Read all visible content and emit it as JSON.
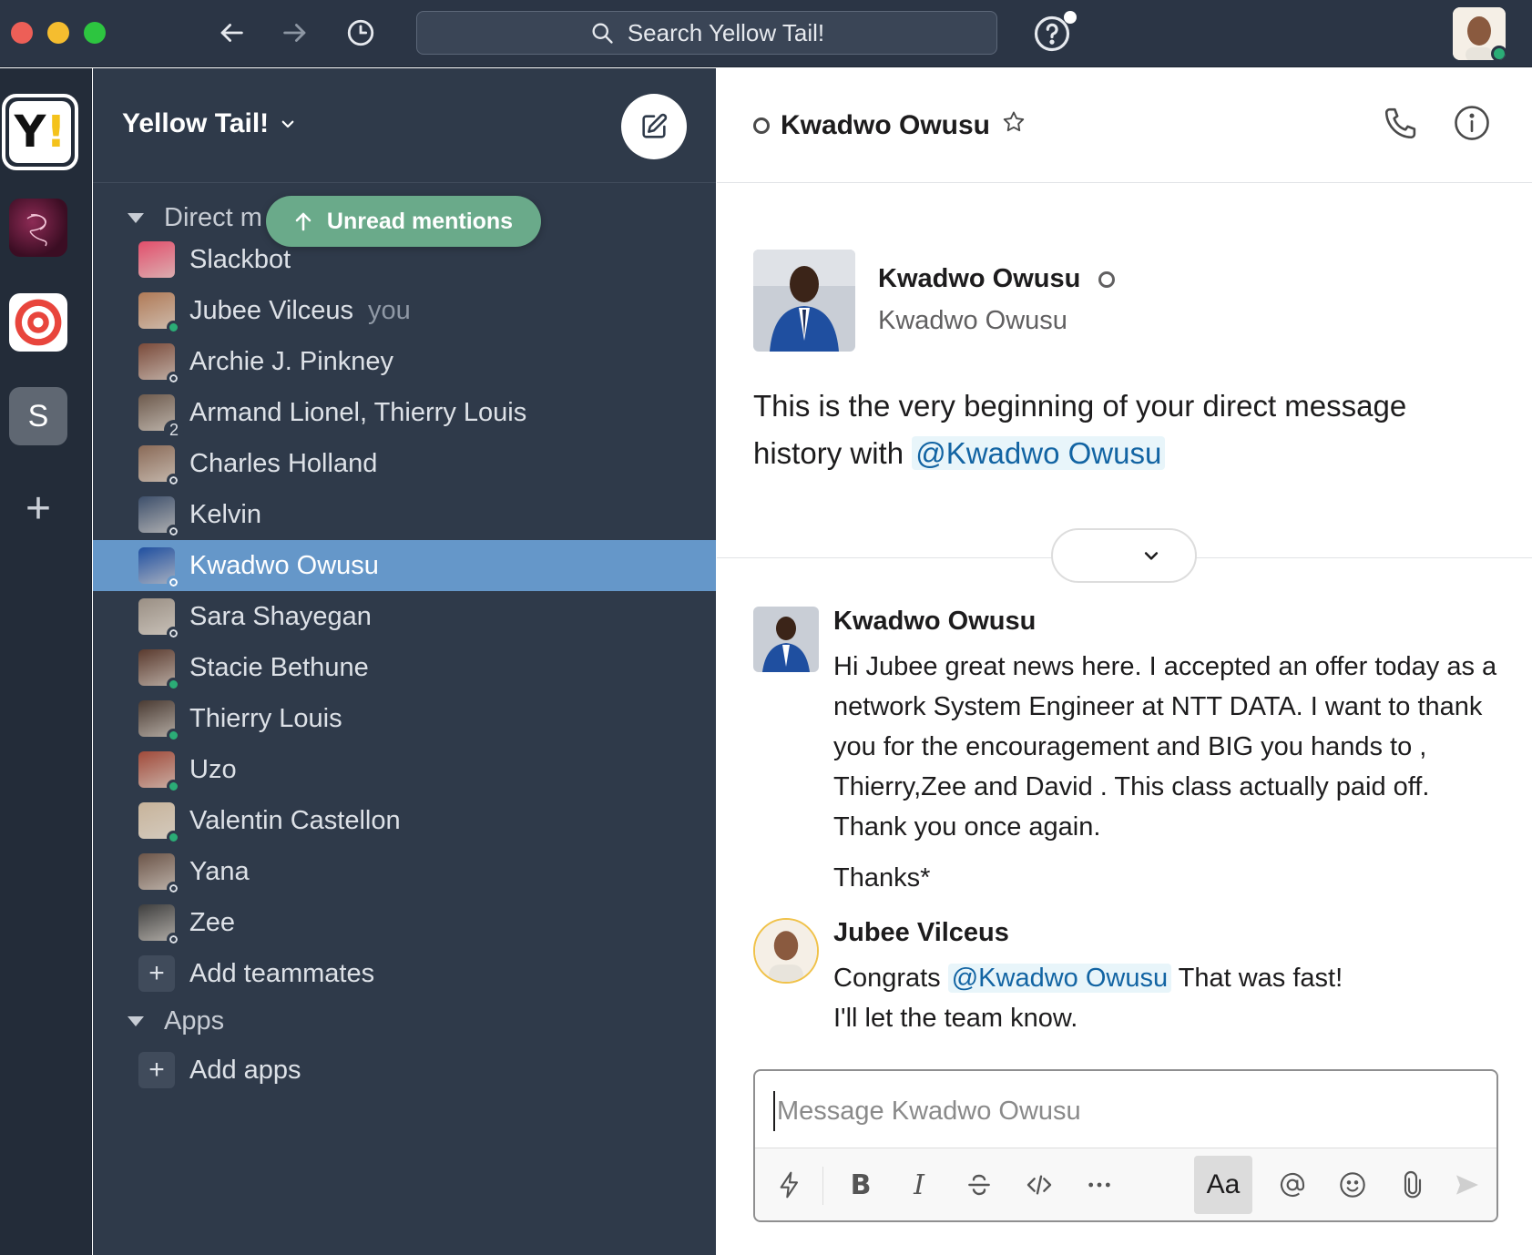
{
  "titlebar": {
    "search_label": "Search Yellow Tail!"
  },
  "workspaces": {
    "active_letter": "Y",
    "active_accent": "!",
    "fourth_letter": "S"
  },
  "sidebar": {
    "workspace_name": "Yellow Tail!",
    "section_dm": "Direct m",
    "unread_pill": "Unread mentions",
    "you_tag": "you",
    "dms": [
      {
        "name": "Slackbot",
        "status": "none",
        "color": "#e24e6b"
      },
      {
        "name": "Jubee Vilceus",
        "status": "online",
        "color": "#b07a57"
      },
      {
        "name": "Archie J. Pinkney",
        "status": "away",
        "color": "#7a4a3a"
      },
      {
        "name": "Armand Lionel, Thierry Louis",
        "status": "count",
        "count": "2",
        "color": "#6d5a4d"
      },
      {
        "name": "Charles Holland",
        "status": "away",
        "color": "#8a6a57"
      },
      {
        "name": "Kelvin",
        "status": "away",
        "color": "#3d4f6b"
      },
      {
        "name": "Kwadwo Owusu",
        "status": "away",
        "color": "#1f4fa0"
      },
      {
        "name": "Sara Shayegan",
        "status": "away",
        "color": "#9a8f84"
      },
      {
        "name": "Stacie Bethune",
        "status": "online",
        "color": "#5a3a2e"
      },
      {
        "name": "Thierry Louis",
        "status": "online",
        "color": "#4a3b33"
      },
      {
        "name": "Uzo",
        "status": "online",
        "color": "#a04a3a"
      },
      {
        "name": "Valentin Castellon",
        "status": "online",
        "color": "#c7b39a"
      },
      {
        "name": "Yana",
        "status": "away",
        "color": "#6b5448"
      },
      {
        "name": "Zee",
        "status": "away",
        "color": "#3e3e3e"
      }
    ],
    "add_teammates": "Add teammates",
    "section_apps": "Apps",
    "add_apps": "Add apps"
  },
  "main": {
    "channel_title": "Kwadwo Owusu",
    "intro": {
      "name": "Kwadwo Owusu",
      "sub": "Kwadwo Owusu",
      "text_before": "This is the very beginning of your direct message history with ",
      "mention": "@Kwadwo Owusu"
    },
    "messages": [
      {
        "author": "Kwadwo Owusu",
        "lines": [
          "Hi Jubee great  news here. I accepted an offer today as a network System Engineer at NTT DATA.  I want to thank you for the encouragement and BIG you hands to , Thierry,Zee and David . This class actually paid off. Thank you once again."
        ],
        "extra": "Thanks*"
      },
      {
        "author": "Jubee Vilceus",
        "before_mention": "Congrats ",
        "mention": "@Kwadwo Owusu",
        "after_mention": " That was fast!",
        "line2": "I'll let the team know."
      }
    ],
    "composer": {
      "placeholder": "Message Kwadwo Owusu",
      "aa_label": "Aa",
      "bold_label": "B",
      "italic_label": "I"
    }
  },
  "colors": {
    "sidebar_bg": "#2f3a4a",
    "active_item": "#6597c9",
    "unread_pill": "#6aaa8a",
    "online": "#2bac76",
    "mention_text": "#1264a3",
    "mention_bg": "#e8f5fa"
  }
}
